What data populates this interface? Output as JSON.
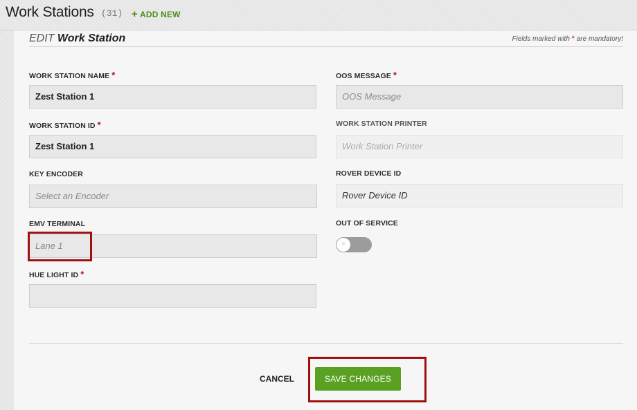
{
  "header": {
    "title": "Work Stations",
    "count": "(31)",
    "add_new_label": "ADD NEW"
  },
  "form": {
    "edit_prefix": "EDIT",
    "edit_title": "Work Station",
    "mandatory_before": "Fields marked with",
    "mandatory_star": "*",
    "mandatory_after": "are mandatory!",
    "work_station_name": {
      "label": "WORK STATION NAME",
      "value": "Zest Station 1"
    },
    "work_station_id": {
      "label": "WORK STATION ID",
      "value": "Zest Station 1"
    },
    "key_encoder": {
      "label": "KEY ENCODER",
      "placeholder": "Select an Encoder"
    },
    "emv_terminal": {
      "label": "EMV TERMINAL",
      "value": "Lane 1"
    },
    "hue_light_id": {
      "label": "HUE LIGHT ID",
      "value": ""
    },
    "oos_message": {
      "label": "OOS MESSAGE",
      "placeholder": "OOS Message"
    },
    "work_station_printer": {
      "label": "WORK STATION PRINTER",
      "placeholder": "Work Station Printer"
    },
    "rover_device_id": {
      "label": "ROVER DEVICE ID",
      "value": "Rover Device ID"
    },
    "out_of_service": {
      "label": "OUT OF SERVICE",
      "state": "off",
      "knob_text": "II"
    },
    "required_star": "*"
  },
  "actions": {
    "cancel_label": "CANCEL",
    "save_label": "SAVE CHANGES"
  },
  "colors": {
    "accent_green": "#5aa123",
    "add_new_green": "#4f8d1d",
    "required_red": "#b31217",
    "highlight_red": "#a10f0f"
  }
}
